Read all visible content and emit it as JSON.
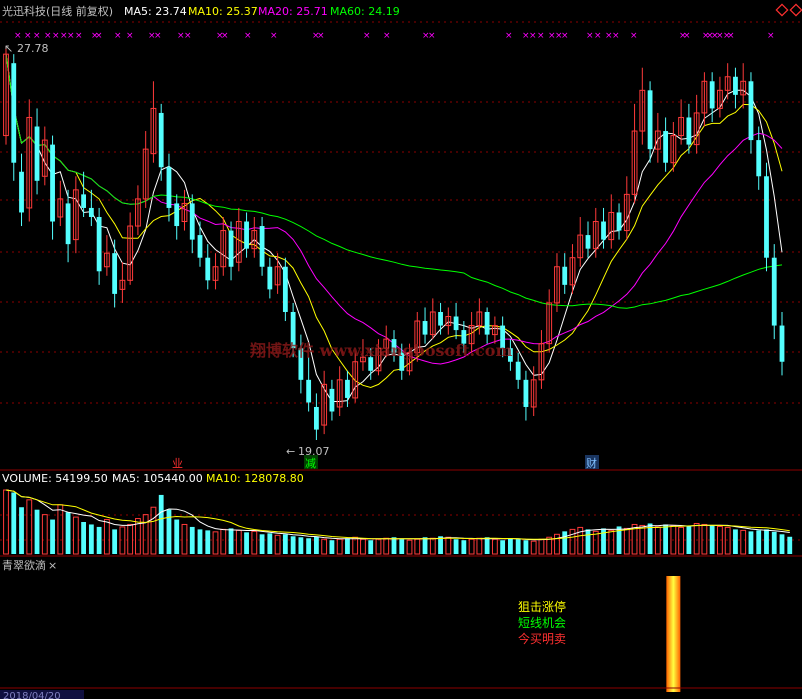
{
  "header": {
    "stock_title": "光迅科技(日线 前复权)",
    "ma_items": [
      {
        "label": "MA5: 23.74",
        "color": "#ffffff"
      },
      {
        "label": "MA10: 25.37",
        "color": "#ffff00"
      },
      {
        "label": "MA20: 25.71",
        "color": "#ff00ff"
      },
      {
        "label": "MA60: 24.19",
        "color": "#00ff00"
      }
    ]
  },
  "price_panel": {
    "high_label": "27.78",
    "low_label": "19.07",
    "watermark": "翔博软件 www.xiangbosoft.com",
    "marker_xs": [
      14,
      24,
      33,
      44,
      52,
      60,
      67,
      75,
      91,
      95,
      114,
      126,
      148,
      154,
      177,
      184,
      216,
      221,
      244,
      270,
      312,
      317,
      363,
      383,
      422,
      428,
      505,
      522,
      529,
      537,
      548,
      555,
      561,
      586,
      594,
      605,
      612,
      630,
      679,
      683,
      702,
      706,
      711,
      716,
      723,
      727,
      767
    ],
    "event_badges": [
      {
        "text": "业",
        "color": "#ff3030"
      },
      {
        "text": "减",
        "color": "#00ff00"
      },
      {
        "text": "财",
        "color": "#80c0ff"
      }
    ]
  },
  "volume_header": [
    {
      "label": "VOLUME: 54199.50",
      "color": "#ffffff"
    },
    {
      "label": "MA5: 105440.00",
      "color": "#ffffff"
    },
    {
      "label": "MA10: 128078.80",
      "color": "#ffff00"
    }
  ],
  "indicator_panel": {
    "title": "青翠欲滴",
    "signals": [
      {
        "text": "狙击涨停",
        "color": "#ffff00"
      },
      {
        "text": "短线机会",
        "color": "#00ff00"
      },
      {
        "text": "今买明卖",
        "color": "#ff3030"
      }
    ]
  },
  "footer": {
    "date_text": "2018/04/20"
  },
  "colors": {
    "up": "#ff3a3a",
    "down": "#54ffff",
    "ma5": "#ffffff",
    "ma10": "#ffff00",
    "ma20": "#ff00ff",
    "ma60": "#00ff00",
    "grid": "#8b0000",
    "marker": "#ff00ff"
  },
  "chart_data": {
    "type": "candlestick",
    "ylim": [
      19.07,
      27.78
    ],
    "candles": [
      {
        "o": 25.8,
        "c": 27.6,
        "h": 27.78,
        "l": 25.6
      },
      {
        "o": 27.4,
        "c": 25.2,
        "h": 27.6,
        "l": 24.8
      },
      {
        "o": 25.0,
        "c": 24.1,
        "h": 25.4,
        "l": 23.8
      },
      {
        "o": 24.2,
        "c": 26.2,
        "h": 26.6,
        "l": 23.9
      },
      {
        "o": 26.0,
        "c": 24.8,
        "h": 26.4,
        "l": 24.5
      },
      {
        "o": 24.9,
        "c": 25.7,
        "h": 26.0,
        "l": 24.7
      },
      {
        "o": 25.6,
        "c": 23.9,
        "h": 25.8,
        "l": 23.5
      },
      {
        "o": 24.0,
        "c": 24.4,
        "h": 24.8,
        "l": 23.8
      },
      {
        "o": 24.3,
        "c": 23.4,
        "h": 24.6,
        "l": 23.0
      },
      {
        "o": 23.5,
        "c": 24.6,
        "h": 24.9,
        "l": 23.2
      },
      {
        "o": 24.5,
        "c": 24.2,
        "h": 25.0,
        "l": 24.0
      },
      {
        "o": 24.2,
        "c": 24.0,
        "h": 24.6,
        "l": 23.8
      },
      {
        "o": 24.0,
        "c": 22.8,
        "h": 24.2,
        "l": 22.5
      },
      {
        "o": 22.9,
        "c": 23.2,
        "h": 23.6,
        "l": 22.7
      },
      {
        "o": 23.2,
        "c": 22.3,
        "h": 23.5,
        "l": 22.0
      },
      {
        "o": 22.4,
        "c": 22.6,
        "h": 23.0,
        "l": 22.1
      },
      {
        "o": 22.6,
        "c": 23.8,
        "h": 24.1,
        "l": 22.5
      },
      {
        "o": 23.8,
        "c": 24.4,
        "h": 24.7,
        "l": 23.6
      },
      {
        "o": 24.4,
        "c": 25.5,
        "h": 25.9,
        "l": 24.2
      },
      {
        "o": 25.4,
        "c": 26.4,
        "h": 27.0,
        "l": 25.2
      },
      {
        "o": 26.3,
        "c": 25.1,
        "h": 26.5,
        "l": 24.8
      },
      {
        "o": 25.1,
        "c": 24.2,
        "h": 25.4,
        "l": 23.9
      },
      {
        "o": 24.3,
        "c": 23.8,
        "h": 24.5,
        "l": 23.5
      },
      {
        "o": 23.9,
        "c": 24.3,
        "h": 24.6,
        "l": 23.7
      },
      {
        "o": 24.3,
        "c": 23.5,
        "h": 24.5,
        "l": 23.2
      },
      {
        "o": 23.6,
        "c": 23.1,
        "h": 23.9,
        "l": 22.9
      },
      {
        "o": 23.1,
        "c": 22.6,
        "h": 23.4,
        "l": 22.4
      },
      {
        "o": 22.6,
        "c": 22.9,
        "h": 23.2,
        "l": 22.4
      },
      {
        "o": 22.9,
        "c": 23.7,
        "h": 24.0,
        "l": 22.7
      },
      {
        "o": 23.7,
        "c": 22.9,
        "h": 23.9,
        "l": 22.6
      },
      {
        "o": 23.0,
        "c": 23.9,
        "h": 24.2,
        "l": 22.8
      },
      {
        "o": 23.9,
        "c": 23.3,
        "h": 24.1,
        "l": 23.1
      },
      {
        "o": 23.3,
        "c": 23.7,
        "h": 24.0,
        "l": 23.1
      },
      {
        "o": 23.8,
        "c": 22.9,
        "h": 24.0,
        "l": 22.7
      },
      {
        "o": 22.9,
        "c": 22.4,
        "h": 23.1,
        "l": 22.2
      },
      {
        "o": 22.5,
        "c": 22.9,
        "h": 23.2,
        "l": 22.3
      },
      {
        "o": 22.9,
        "c": 21.9,
        "h": 23.1,
        "l": 21.7
      },
      {
        "o": 21.9,
        "c": 21.1,
        "h": 22.1,
        "l": 20.9
      },
      {
        "o": 21.1,
        "c": 20.4,
        "h": 21.4,
        "l": 20.1
      },
      {
        "o": 20.4,
        "c": 19.9,
        "h": 20.9,
        "l": 19.7
      },
      {
        "o": 19.8,
        "c": 19.3,
        "h": 20.1,
        "l": 19.07
      },
      {
        "o": 19.4,
        "c": 20.3,
        "h": 20.6,
        "l": 19.2
      },
      {
        "o": 20.2,
        "c": 19.7,
        "h": 20.4,
        "l": 19.5
      },
      {
        "o": 19.8,
        "c": 20.4,
        "h": 20.7,
        "l": 19.6
      },
      {
        "o": 20.4,
        "c": 20.0,
        "h": 20.6,
        "l": 19.8
      },
      {
        "o": 20.0,
        "c": 20.8,
        "h": 21.0,
        "l": 19.9
      },
      {
        "o": 20.8,
        "c": 20.9,
        "h": 21.3,
        "l": 20.6
      },
      {
        "o": 20.9,
        "c": 20.6,
        "h": 21.1,
        "l": 20.4
      },
      {
        "o": 20.6,
        "c": 21.1,
        "h": 21.3,
        "l": 20.5
      },
      {
        "o": 21.1,
        "c": 21.3,
        "h": 21.6,
        "l": 20.9
      },
      {
        "o": 21.3,
        "c": 21.0,
        "h": 21.5,
        "l": 20.8
      },
      {
        "o": 21.0,
        "c": 20.6,
        "h": 21.2,
        "l": 20.4
      },
      {
        "o": 20.6,
        "c": 21.0,
        "h": 21.2,
        "l": 20.5
      },
      {
        "o": 21.0,
        "c": 21.7,
        "h": 21.9,
        "l": 20.8
      },
      {
        "o": 21.7,
        "c": 21.4,
        "h": 22.0,
        "l": 21.2
      },
      {
        "o": 21.4,
        "c": 21.9,
        "h": 22.2,
        "l": 21.3
      },
      {
        "o": 21.9,
        "c": 21.6,
        "h": 22.1,
        "l": 21.4
      },
      {
        "o": 21.6,
        "c": 21.8,
        "h": 22.0,
        "l": 21.4
      },
      {
        "o": 21.8,
        "c": 21.5,
        "h": 22.1,
        "l": 21.3
      },
      {
        "o": 21.5,
        "c": 21.2,
        "h": 21.7,
        "l": 21.0
      },
      {
        "o": 21.2,
        "c": 21.6,
        "h": 21.9,
        "l": 21.0
      },
      {
        "o": 21.6,
        "c": 21.9,
        "h": 22.2,
        "l": 21.4
      },
      {
        "o": 21.9,
        "c": 21.4,
        "h": 22.0,
        "l": 21.2
      },
      {
        "o": 21.4,
        "c": 21.6,
        "h": 21.8,
        "l": 21.2
      },
      {
        "o": 21.6,
        "c": 21.1,
        "h": 21.8,
        "l": 20.9
      },
      {
        "o": 21.1,
        "c": 20.8,
        "h": 21.3,
        "l": 20.6
      },
      {
        "o": 20.8,
        "c": 20.4,
        "h": 21.0,
        "l": 20.2
      },
      {
        "o": 20.4,
        "c": 19.8,
        "h": 20.6,
        "l": 19.5
      },
      {
        "o": 19.8,
        "c": 20.4,
        "h": 20.7,
        "l": 19.6
      },
      {
        "o": 20.4,
        "c": 21.2,
        "h": 21.5,
        "l": 20.2
      },
      {
        "o": 21.2,
        "c": 22.1,
        "h": 22.4,
        "l": 21.0
      },
      {
        "o": 22.1,
        "c": 22.9,
        "h": 23.2,
        "l": 21.9
      },
      {
        "o": 22.9,
        "c": 22.5,
        "h": 23.2,
        "l": 22.3
      },
      {
        "o": 22.5,
        "c": 23.1,
        "h": 23.4,
        "l": 22.3
      },
      {
        "o": 23.1,
        "c": 23.6,
        "h": 24.0,
        "l": 22.9
      },
      {
        "o": 23.6,
        "c": 23.3,
        "h": 23.9,
        "l": 23.1
      },
      {
        "o": 23.3,
        "c": 23.9,
        "h": 24.2,
        "l": 23.1
      },
      {
        "o": 23.9,
        "c": 23.5,
        "h": 24.2,
        "l": 23.3
      },
      {
        "o": 23.5,
        "c": 24.1,
        "h": 24.5,
        "l": 23.3
      },
      {
        "o": 24.1,
        "c": 23.7,
        "h": 24.3,
        "l": 23.5
      },
      {
        "o": 23.7,
        "c": 24.5,
        "h": 24.9,
        "l": 23.5
      },
      {
        "o": 24.5,
        "c": 25.9,
        "h": 26.5,
        "l": 24.3
      },
      {
        "o": 25.9,
        "c": 26.8,
        "h": 27.3,
        "l": 25.6
      },
      {
        "o": 26.8,
        "c": 25.5,
        "h": 27.0,
        "l": 25.2
      },
      {
        "o": 25.5,
        "c": 25.9,
        "h": 26.3,
        "l": 25.2
      },
      {
        "o": 25.9,
        "c": 25.2,
        "h": 26.2,
        "l": 25.0
      },
      {
        "o": 25.2,
        "c": 25.8,
        "h": 26.1,
        "l": 25.0
      },
      {
        "o": 25.8,
        "c": 26.2,
        "h": 26.6,
        "l": 25.6
      },
      {
        "o": 26.2,
        "c": 25.6,
        "h": 26.5,
        "l": 25.4
      },
      {
        "o": 25.6,
        "c": 26.3,
        "h": 26.7,
        "l": 25.4
      },
      {
        "o": 26.3,
        "c": 27.0,
        "h": 27.2,
        "l": 26.0
      },
      {
        "o": 27.0,
        "c": 26.4,
        "h": 27.2,
        "l": 26.1
      },
      {
        "o": 26.4,
        "c": 26.8,
        "h": 27.1,
        "l": 26.2
      },
      {
        "o": 26.8,
        "c": 27.1,
        "h": 27.4,
        "l": 26.6
      },
      {
        "o": 27.1,
        "c": 26.7,
        "h": 27.3,
        "l": 26.4
      },
      {
        "o": 26.7,
        "c": 27.0,
        "h": 27.4,
        "l": 26.4
      },
      {
        "o": 27.0,
        "c": 25.7,
        "h": 27.2,
        "l": 25.4
      },
      {
        "o": 25.7,
        "c": 24.9,
        "h": 26.0,
        "l": 24.6
      },
      {
        "o": 24.9,
        "c": 23.1,
        "h": 25.2,
        "l": 22.8
      },
      {
        "o": 23.1,
        "c": 21.6,
        "h": 23.4,
        "l": 21.3
      },
      {
        "o": 21.6,
        "c": 20.8,
        "h": 21.9,
        "l": 20.5
      }
    ],
    "volume": {
      "header_values": {
        "volume": 54199.5,
        "ma5": 105440.0,
        "ma10": 128078.8
      },
      "values": [
        130,
        125,
        95,
        110,
        90,
        80,
        70,
        100,
        85,
        75,
        65,
        60,
        55,
        70,
        50,
        55,
        60,
        72,
        80,
        95,
        120,
        90,
        70,
        60,
        55,
        50,
        48,
        45,
        50,
        52,
        48,
        44,
        46,
        40,
        42,
        38,
        40,
        36,
        34,
        32,
        35,
        30,
        28,
        30,
        32,
        34,
        30,
        28,
        30,
        32,
        34,
        30,
        28,
        30,
        34,
        32,
        36,
        34,
        30,
        28,
        30,
        32,
        34,
        30,
        28,
        32,
        30,
        28,
        26,
        30,
        34,
        40,
        46,
        50,
        54,
        50,
        46,
        52,
        48,
        56,
        52,
        60,
        58,
        62,
        55,
        60,
        58,
        54,
        56,
        62,
        60,
        58,
        56,
        54,
        50,
        48,
        46,
        48,
        50,
        45,
        40,
        35
      ]
    },
    "indicator": {
      "signal_index": 86
    }
  }
}
